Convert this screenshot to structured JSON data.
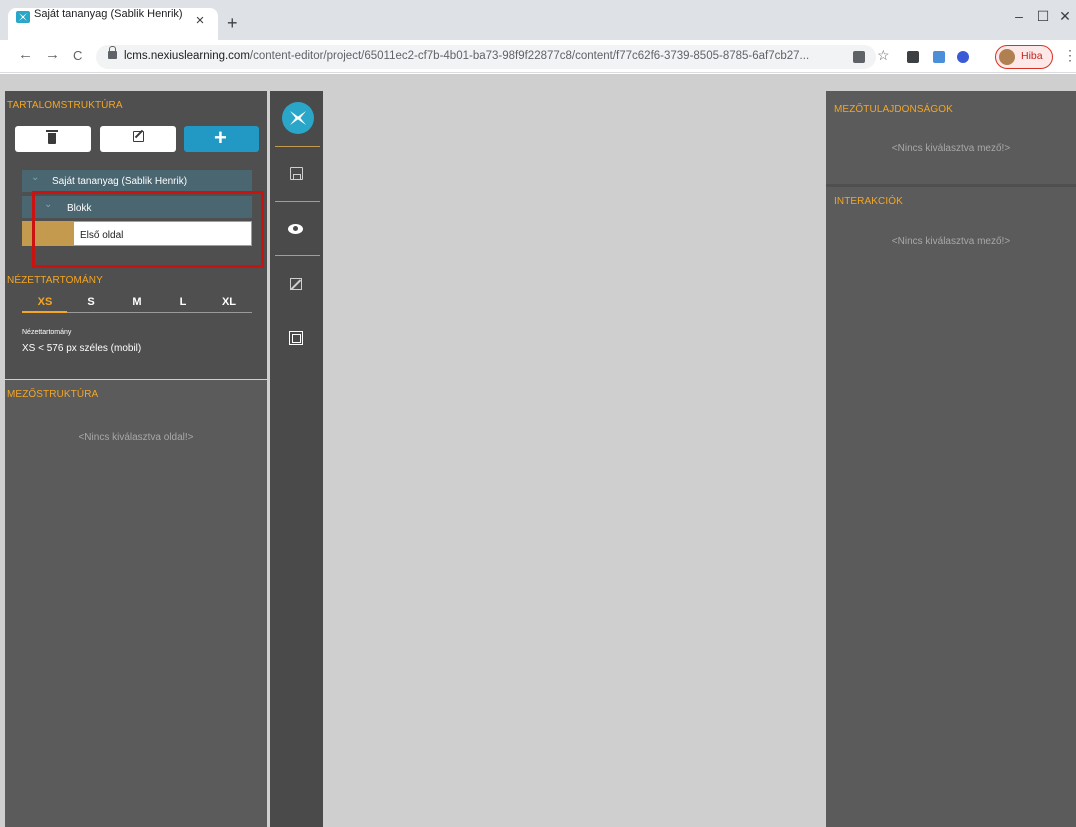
{
  "browser": {
    "tab_title": "Saját tananyag (Sablik Henrik)",
    "tab_close": "×",
    "new_tab": "+",
    "win_min": "–",
    "win_max": "☐",
    "win_close": "✕",
    "nav_back": "←",
    "nav_forward": "→",
    "nav_reload": "C",
    "url_domain": "lcms.nexiuslearning.com",
    "url_path": "/content-editor/project/65011ec2-cf7b-4b01-ba73-98f9f22877c8/content/f77c62f6-3739-8505-8785-6af7cb27...",
    "star": "☆",
    "profile_label": "Hiba",
    "menu": "⋮"
  },
  "left": {
    "content_title": "TARTALOMSTRUKTÚRA",
    "tree": {
      "root": "Saját tananyag (Sablik Henrik)",
      "block": "Blokk",
      "page": "Első oldal",
      "chevron": "⌄"
    },
    "viewport": {
      "title": "NÉZETTARTOMÁNY",
      "sizes": [
        "XS",
        "S",
        "M",
        "L",
        "XL"
      ],
      "selected": "XS",
      "info_label": "Nézettartomány",
      "info_value": "XS < 576 px széles (mobil)"
    },
    "field_structure": {
      "title": "MEZŐSTRUKTÚRA",
      "empty": "<Nincs kiválasztva oldal!>"
    }
  },
  "right": {
    "properties": {
      "title": "MEZŐTULAJDONSÁGOK",
      "empty": "<Nincs kiválasztva mező!>"
    },
    "interactions": {
      "title": "INTERAKCIÓK",
      "empty": "<Nincs kiválasztva mező!>"
    }
  },
  "colors": {
    "accent": "#f5a623",
    "primary": "#2299c4",
    "highlight": "#cc1111"
  },
  "icons": [
    "trash-icon",
    "edit-icon",
    "plus-icon",
    "save-icon",
    "eye-icon",
    "resize-icon",
    "frame-icon",
    "logo-icon",
    "lock-icon"
  ]
}
